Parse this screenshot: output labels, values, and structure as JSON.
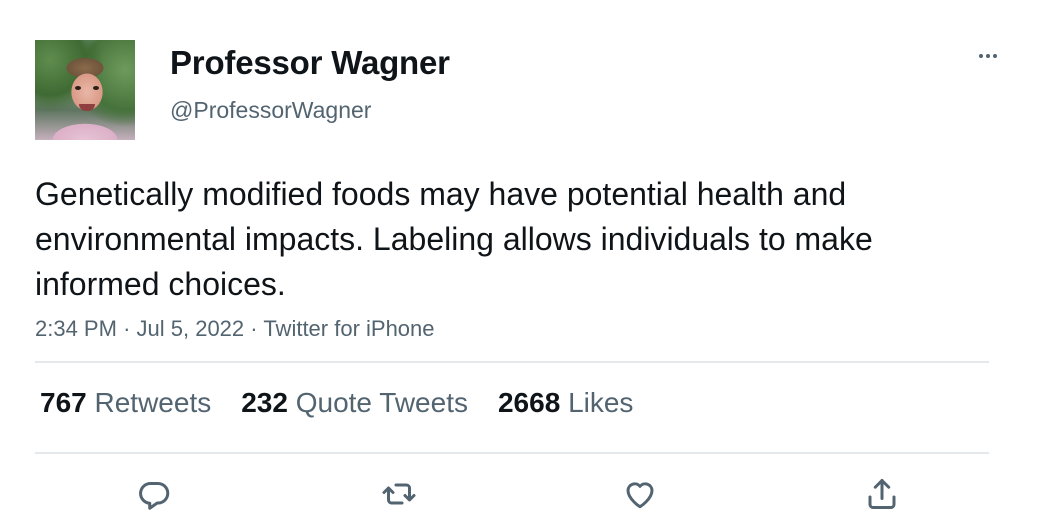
{
  "tweet": {
    "author_name": "Professor Wagner",
    "author_handle": "@ProfessorWagner",
    "text": "Genetically modified foods may have potential health and environmental impacts. Labeling allows individuals to make informed choices.",
    "time": "2:34 PM",
    "date": "Jul 5, 2022",
    "source": "Twitter for iPhone",
    "separator": "·"
  },
  "stats": {
    "retweets_count": "767",
    "retweets_label": "Retweets",
    "quotes_count": "232",
    "quotes_label": "Quote Tweets",
    "likes_count": "2668",
    "likes_label": "Likes"
  },
  "icons": {
    "more": "more-horizontal-icon",
    "reply": "reply-icon",
    "retweet": "retweet-icon",
    "like": "heart-icon",
    "share": "share-icon"
  },
  "colors": {
    "primary_text": "#0f1419",
    "secondary_text": "#536471",
    "divider": "#e6e9eb"
  }
}
